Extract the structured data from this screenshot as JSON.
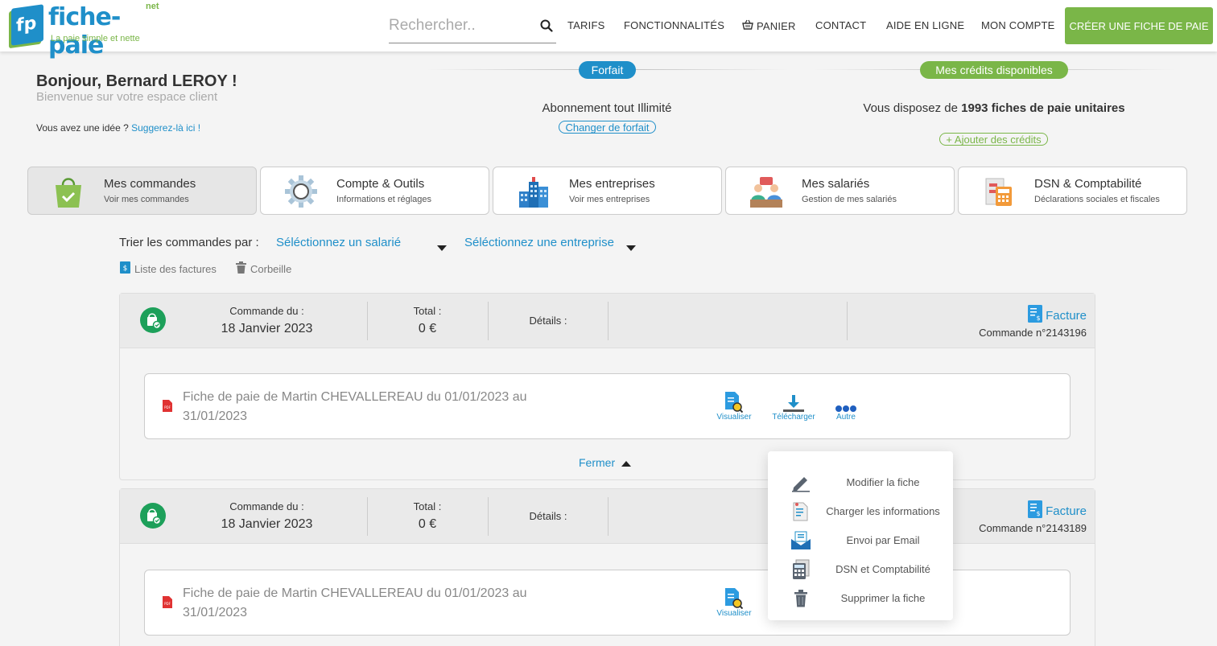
{
  "header": {
    "logo_name": "fiche-paie",
    "logo_net": "net",
    "logo_badge": "fp",
    "logo_tagline": "La paie simple et nette",
    "search_placeholder": "Rechercher..",
    "nav": {
      "tarifs": "TARIFS",
      "fonctionnalites": "FONCTIONNALITÉS",
      "panier": "PANIER",
      "contact": "CONTACT",
      "aide": "AIDE EN LIGNE",
      "compte": "MON COMPTE"
    },
    "cta": "CRÉER UNE FICHE DE PAIE"
  },
  "greeting": {
    "hello": "Bonjour, Bernard LEROY !",
    "welcome": "Bienvenue sur votre espace client",
    "idea_prefix": "Vous avez une idée ? ",
    "idea_link": "Suggerez-là ici !"
  },
  "forfait": {
    "pill": "Forfait",
    "text": "Abonnement tout Illimité",
    "button": "Changer de forfait"
  },
  "credits": {
    "pill": "Mes crédits disponibles",
    "prefix": "Vous disposez de ",
    "bold": "1993 fiches de paie unitaires",
    "button": "+ Ajouter des crédits"
  },
  "tabs": [
    {
      "title": "Mes commandes",
      "subtitle": "Voir mes commandes"
    },
    {
      "title": "Compte & Outils",
      "subtitle": "Informations et réglages"
    },
    {
      "title": "Mes entreprises",
      "subtitle": "Voir mes entreprises"
    },
    {
      "title": "Mes salariés",
      "subtitle": "Gestion de mes salariés"
    },
    {
      "title": "DSN & Comptabilité",
      "subtitle": "Déclarations sociales et fiscales"
    }
  ],
  "filters": {
    "label": "Trier les commandes par :",
    "salarie": "Séléctionnez un salarié",
    "entreprise": "Séléctionnez une entreprise",
    "factures": "Liste des factures",
    "corbeille": "Corbeille"
  },
  "orders": [
    {
      "date_label": "Commande du :",
      "date": "18 Janvier 2023",
      "total_label": "Total :",
      "total": "0 €",
      "details_label": "Détails :",
      "facture": "Facture",
      "number": "Commande n°2143196",
      "item_title": "Fiche de paie de Martin CHEVALLEREAU du 01/01/2023 au 31/01/2023",
      "actions": {
        "visualiser": "Visualiser",
        "telecharger": "Télécharger",
        "autre": "Autre"
      },
      "fermer": "Fermer"
    },
    {
      "date_label": "Commande du :",
      "date": "18 Janvier 2023",
      "total_label": "Total :",
      "total": "0 €",
      "details_label": "Détails :",
      "facture": "Facture",
      "number": "Commande n°2143189",
      "item_title": "Fiche de paie de Martin CHEVALLEREAU du 01/01/2023 au 31/01/2023",
      "actions": {
        "visualiser": "Visualiser"
      }
    }
  ],
  "menu": [
    {
      "label": "Modifier la fiche",
      "icon": "pencil-icon"
    },
    {
      "label": "Charger les informations",
      "icon": "document-upload-icon"
    },
    {
      "label": "Envoi par Email",
      "icon": "email-icon"
    },
    {
      "label": "DSN et Comptabilité",
      "icon": "calculator-icon"
    },
    {
      "label": "Supprimer la fiche",
      "icon": "trash-icon"
    }
  ],
  "colors": {
    "brand_blue": "#1f8fc9",
    "brand_green": "#7ab648",
    "success_green": "#1da05a"
  }
}
